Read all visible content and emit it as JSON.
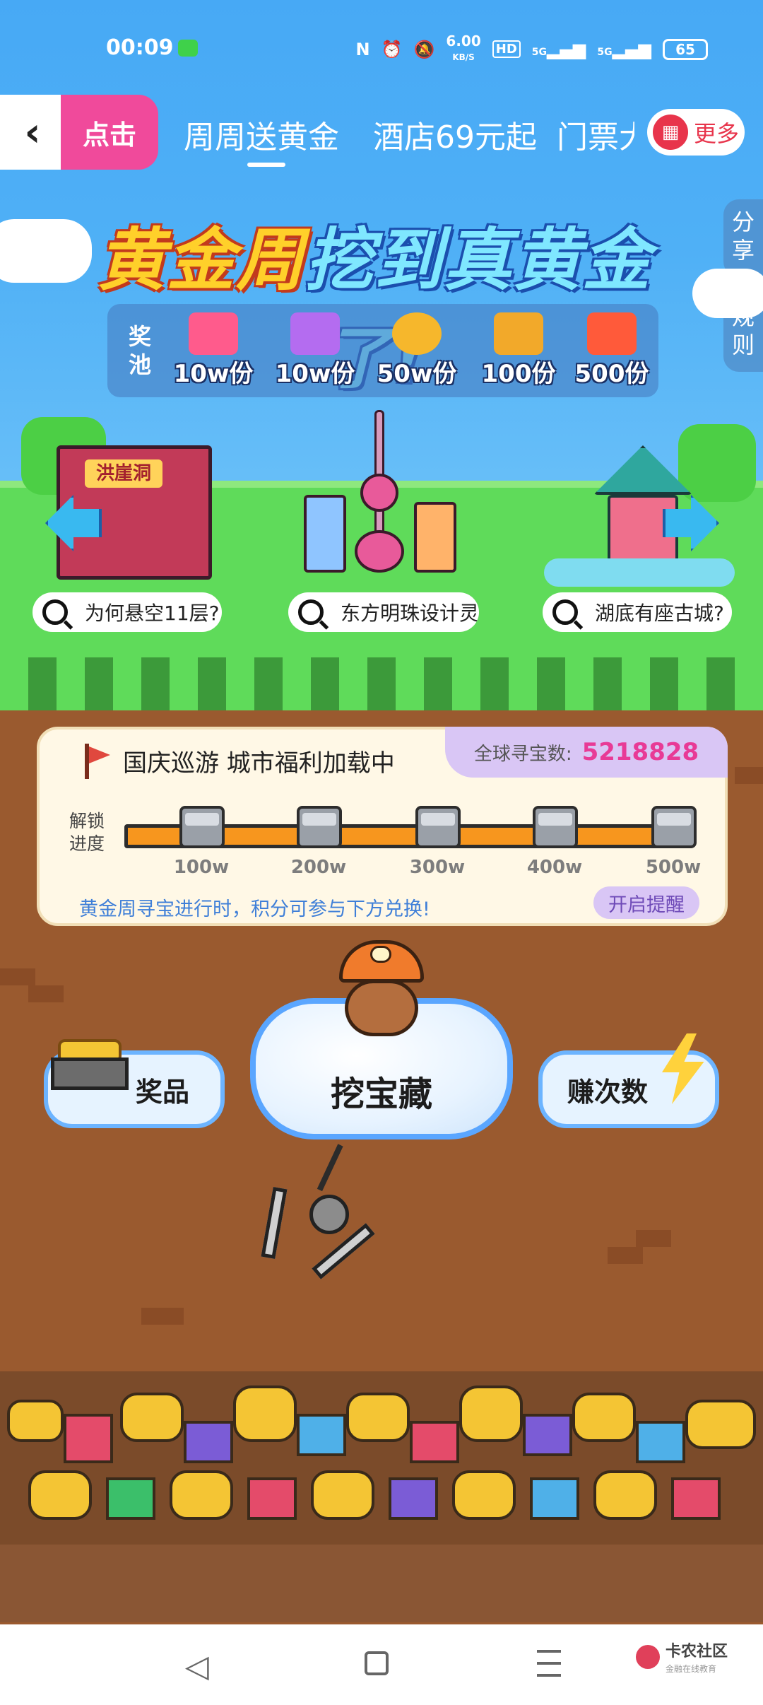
{
  "status_bar": {
    "time": "00:09",
    "speed": "6.00",
    "speed_unit": "KB/S",
    "hd_label": "HD",
    "net1": "5G",
    "net2": "5G",
    "battery": "65"
  },
  "tabbar": {
    "click_label": "点击",
    "tabs": [
      {
        "label": "周周送黄金",
        "active": true
      },
      {
        "label": "酒店69元起",
        "active": false
      },
      {
        "label": "门票大",
        "active": false
      }
    ],
    "more_label": "更多"
  },
  "side_pills": {
    "share": "分享",
    "rules": "规则"
  },
  "banner": {
    "part1": "黄金周",
    "part2": "挖到真黄金了!"
  },
  "prize_pool": {
    "label": "奖池",
    "items": [
      {
        "qty": "10w份",
        "icon": "red-ticket-icon",
        "color": "#ff5b8c"
      },
      {
        "qty": "10w份",
        "icon": "purple-ticket-icon",
        "color": "#b46cf0"
      },
      {
        "qty": "50w份",
        "icon": "gold-coin-icon",
        "color": "#f6b72c"
      },
      {
        "qty": "100份",
        "icon": "gold-bar-icon",
        "color": "#f2a92a"
      },
      {
        "qty": "500份",
        "icon": "gift-box-icon",
        "color": "#ff5a3a"
      }
    ]
  },
  "scenes": [
    {
      "search": "为何悬空11层?",
      "sign": "洪崖洞"
    },
    {
      "search": "东方明珠设计灵感",
      "sign": ""
    },
    {
      "search": "湖底有座古城?",
      "sign": ""
    }
  ],
  "progress": {
    "title": "国庆巡游 城市福利加载中",
    "global_label": "全球寻宝数:",
    "global_count": "5218828",
    "unlock_label": "解锁进度",
    "milestones": [
      "100w",
      "200w",
      "300w",
      "400w",
      "500w"
    ],
    "hint": "黄金周寻宝进行时，积分可参与下方兑换!",
    "remind_label": "开启提醒"
  },
  "actions": {
    "prizes_label": "奖品",
    "dig_label": "挖宝藏",
    "earn_label": "赚次数"
  },
  "watermark": {
    "title": "卡农社区",
    "subtitle": "金融在线教育"
  },
  "colors": {
    "sky": "#47a9f5",
    "grass": "#5fdb5a",
    "dirt": "#9a5a2f",
    "accent_pink": "#f04a9b",
    "count_pink": "#e83a96",
    "progress_orange": "#f7961e"
  }
}
